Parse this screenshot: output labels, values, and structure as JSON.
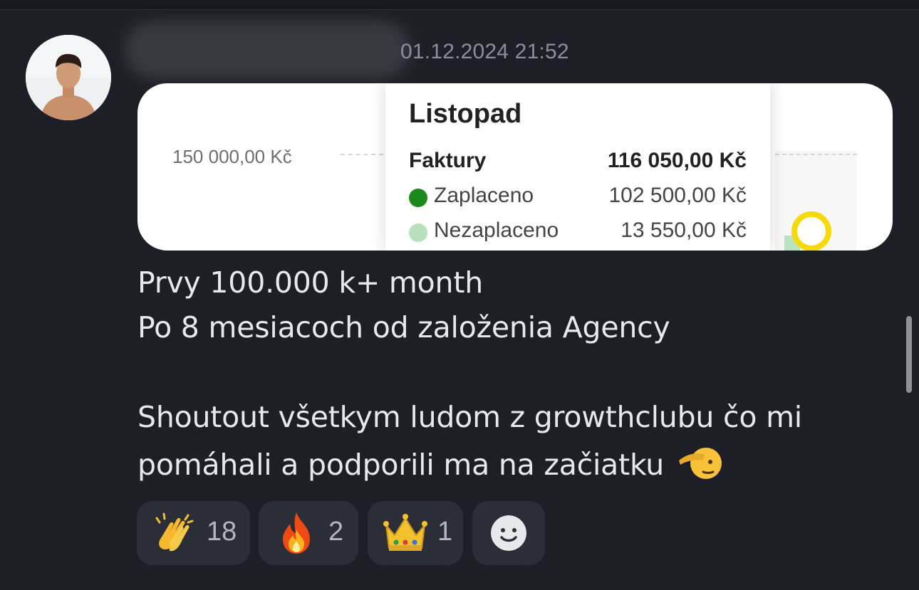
{
  "message": {
    "timestamp": "01.12.2024 21:52",
    "lines": [
      "Prvy 100.000 k+ month",
      "Po 8 mesiacoch od založenia Agency",
      "Shoutout všetkym ludom z growthclubu čo mi",
      "pomáhali  a podporili ma na začiatku"
    ]
  },
  "attachment": {
    "axis_label": "150 000,00 Kč",
    "tooltip": {
      "title": "Listopad",
      "rows": [
        {
          "label": "Faktury",
          "value": "116 050,00 Kč"
        },
        {
          "label": "Zaplaceno",
          "value": "102 500,00 Kč",
          "color": "#1a8a1a"
        },
        {
          "label": "Nezaplaceno",
          "value": "13 550,00 Kč",
          "color": "#b8e0bc"
        }
      ]
    }
  },
  "reactions": [
    {
      "emoji": "clapping-hands",
      "count": "18"
    },
    {
      "emoji": "fire",
      "count": "2"
    },
    {
      "emoji": "crown",
      "count": "1"
    }
  ],
  "icons": {
    "avatar": "person-avatar",
    "add_reaction": "smiley-face-icon",
    "saluting_face": "saluting-face-emoji"
  },
  "colors": {
    "background": "#1e1f26",
    "reaction_bg": "#2c2e37",
    "text": "#e7e8ec",
    "timestamp": "#8d8f98"
  }
}
